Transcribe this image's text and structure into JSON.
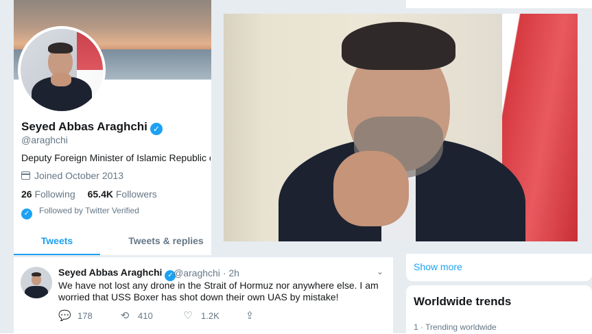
{
  "profile": {
    "display_name": "Seyed Abbas Araghchi",
    "handle": "@araghchi",
    "bio": "Deputy Foreign Minister of Islamic Republic of Iran",
    "joined": "Joined October 2013",
    "following_count": "26",
    "following_label": "Following",
    "followers_count": "65.4K",
    "followers_label": "Followers",
    "followed_by": "Followed by Twitter Verified"
  },
  "tabs": [
    {
      "label": "Tweets",
      "active": true
    },
    {
      "label": "Tweets & replies",
      "active": false
    }
  ],
  "tweet": {
    "name": "Seyed Abbas Araghchi",
    "handle": "@araghchi",
    "time": "· 2h",
    "text": "We have not lost any drone in the Strait of Hormuz nor anywhere else. I am worried that USS Boxer has shot down their own UAS by mistake!",
    "replies": "178",
    "retweets": "410",
    "likes": "1.2K"
  },
  "sidebar": {
    "show_more": "Show more",
    "trends_title": "Worldwide trends",
    "trend_1_meta": "1 · Trending worldwide"
  },
  "colors": {
    "accent": "#1da1f2",
    "secondary_text": "#657786",
    "background": "#e6ecf0"
  }
}
